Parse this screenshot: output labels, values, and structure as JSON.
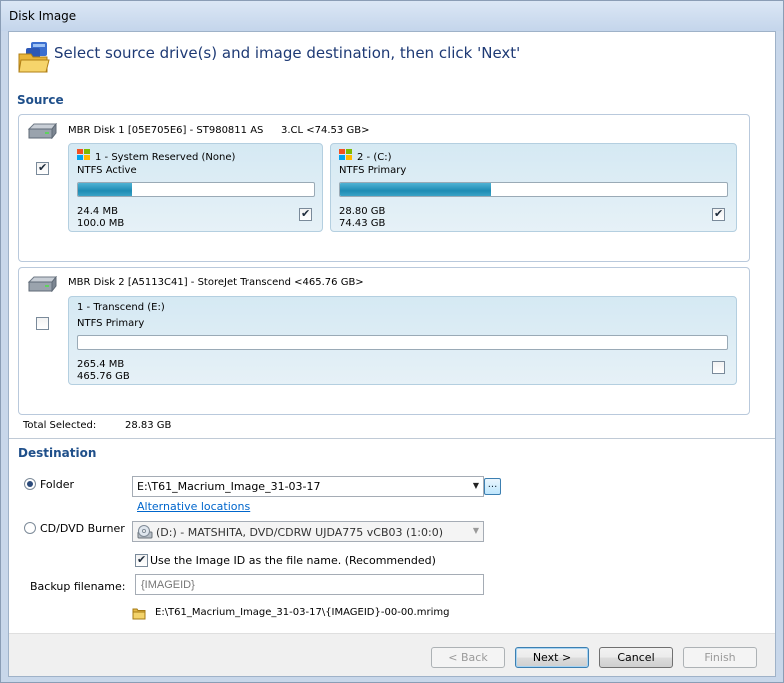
{
  "window": {
    "title": "Disk Image"
  },
  "header": {
    "instruction": "Select source drive(s) and image destination, then click 'Next'"
  },
  "source": {
    "label": "Source",
    "disks": [
      {
        "name": "MBR Disk 1 [05E705E6] - ST980811 AS",
        "extra": "3.CL  <74.53 GB>",
        "checked": true,
        "partitions": [
          {
            "title": "1 - System Reserved (None)",
            "fs": "NTFS Active",
            "used": "24.4 MB",
            "total": "100.0 MB",
            "fill_pct": 23,
            "checked": true,
            "win_flag": true
          },
          {
            "title": "2 -  (C:)",
            "fs": "NTFS Primary",
            "used": "28.80 GB",
            "total": "74.43 GB",
            "fill_pct": 39,
            "checked": true,
            "win_flag": true
          }
        ]
      },
      {
        "name": "MBR Disk 2 [A5113C41] - StoreJet Transcend  <465.76 GB>",
        "extra": "",
        "checked": false,
        "partitions": [
          {
            "title": "1 - Transcend (E:)",
            "fs": "NTFS Primary",
            "used": "265.4 MB",
            "total": "465.76 GB",
            "fill_pct": 0,
            "checked": false,
            "win_flag": false
          }
        ]
      }
    ],
    "total_label": "Total Selected:",
    "total_value": "28.83 GB"
  },
  "destination": {
    "label": "Destination",
    "folder_label": "Folder",
    "folder_selected": true,
    "folder_path": "E:\\T61_Macrium_Image_31-03-17",
    "browse_label": "...",
    "alt_link": "Alternative locations",
    "burner_label": "CD/DVD Burner",
    "burner_value": "(D:) - MATSHITA, DVD/CDRW UJDA775 vCB03 (1:0:0)",
    "use_image_id_label": "Use the Image ID as the file name.  (Recommended)",
    "use_image_id_checked": true,
    "backup_filename_label": "Backup filename:",
    "backup_filename_value": "{IMAGEID}",
    "result_path": "E:\\T61_Macrium_Image_31-03-17\\{IMAGEID}-00-00.mrimg"
  },
  "buttons": {
    "back": "< Back",
    "next": "Next >",
    "cancel": "Cancel",
    "finish": "Finish"
  },
  "colors": {
    "accent": "#1f4f8a",
    "bar_fill": "#1e8cb4",
    "link": "#0066cc"
  }
}
